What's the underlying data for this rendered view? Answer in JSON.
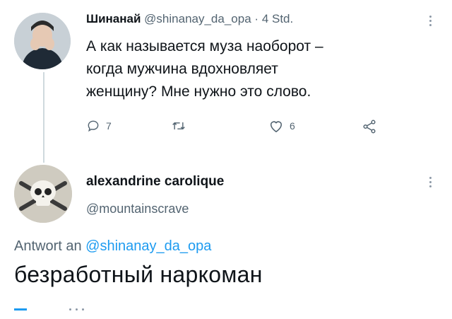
{
  "tweet": {
    "author_name": "Шинанай",
    "handle": "@shinanay_da_opa",
    "separator": "·",
    "time": "4 Std.",
    "text_lines": [
      "А как называется муза наоборот –",
      "когда мужчина вдохновляет",
      "женщину? Мне нужно это слово."
    ],
    "actions": {
      "replies": "7",
      "likes": "6"
    }
  },
  "reply": {
    "author_name": "alexandrine carolique",
    "handle": "@mountainscrave",
    "replying_prefix": "Antwort an",
    "replying_to": "@shinanay_da_opa",
    "text": "безработный наркоман"
  },
  "icons": {
    "reply": "speech-bubble-icon",
    "retweet": "retweet-icon",
    "like": "heart-icon",
    "share": "share-icon",
    "more": "vertical-dots-icon"
  },
  "colors": {
    "accent": "#1d9bf0",
    "muted": "#536471",
    "text": "#0f1419"
  }
}
